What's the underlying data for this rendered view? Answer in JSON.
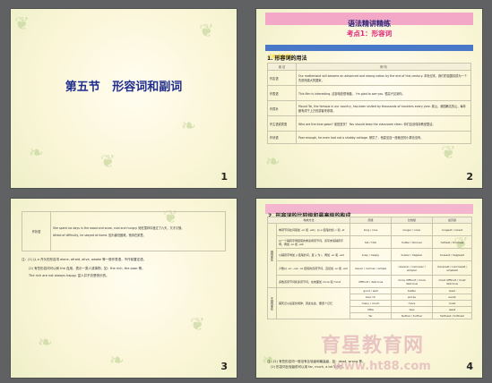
{
  "slides": [
    {
      "number": "1",
      "title_section": "第五节",
      "title_main": "形容词和副词"
    },
    {
      "number": "2",
      "banner": "语法精讲精练",
      "subtitle": "考点1：形容词",
      "tag": "【考点精讲】",
      "heading": "1. 形容词的用法",
      "table_header": [
        "用 法",
        "例 句"
      ],
      "rows": [
        {
          "use": "作定语",
          "example": "Our motherland will become an advanced and strong nation by the end of this century. 本世纪末，我们的祖国将成为一个先进而强大的国家。"
        },
        {
          "use": "作表语",
          "example": "This film is interesting. 这部电影很有趣。 I'm glad to see you. 很高兴见到你。"
        },
        {
          "use": "作宾补",
          "example": "Mount Tai, the famous in our country, has been visited by thousands of travelers every year. 泰山，我国著名的山，每年都有成千上万的游客来参观。"
        },
        {
          "use": "作主语或宾语",
          "example": "Who are the blue gown? 谁是蓝衣？ You should keep the classroom clean. 你们应该保持教室整洁。"
        },
        {
          "use": "作状语",
          "example": "Poor enough, he even had not a shabby cottage. 够穷了，他甚至连一座破旧的小屋也没有。"
        }
      ]
    },
    {
      "number": "3",
      "cell_label": "作状语",
      "cell_text_1": "She spent six days in the wood and snow, cold and hungry. 她在雪林中度过了六天，又冷又饿。",
      "cell_text_2": "Afraid of difficulty, he stayed at home. 因为害怕困难，他待在家里。",
      "note_1": "注：(1) 以 a 开头的形容词 alone, afraid, alive, awake 等一般作表语，不作前置定语。",
      "note_2": "(2) 有些形容词可以和 the 连用，表示一类人或事物，如：the rich, the poor 等。",
      "note_3": "The rich are not always happy. 富人并不总是快乐的。"
    },
    {
      "number": "4",
      "heading": "2. 形容词的比较级和最高级的构成",
      "table_header": [
        "构成方法",
        "原级",
        "比较级",
        "最高级"
      ],
      "group_regular": "规则变化",
      "group_irregular": "不规则变化",
      "rows": [
        {
          "rule": "单音节词在词尾加 -er 和 -est；以 e 结尾的加 -r 和 -st",
          "pos": "long / nice",
          "comp": "longer / nicer",
          "sup": "longest / nicest"
        },
        {
          "rule": "以一个辅音字母结尾的重读闭音节词，双写末尾辅音字母，再加 -er 和 -est",
          "pos": "hot / thin",
          "comp": "hotter / thinner",
          "sup": "hottest / thinnest"
        },
        {
          "rule": "以辅音字母加 y 结尾的词，变 y 为 i，再加 -er 和 -est",
          "pos": "busy / happy",
          "comp": "busier / happier",
          "sup": "busiest / happiest"
        },
        {
          "rule": "少数以 -er, -ow, -le 结尾的双音节词，直接加 -er 和 -est",
          "pos": "clever / narrow / simple",
          "comp": "cleverer / narrower / simpler",
          "sup": "cleverest / narrowest / simplest"
        },
        {
          "rule": "多数双音节词和多音节词，在前面加 more 和 most",
          "pos": "difficult / delicious",
          "comp": "more difficult / more delicious",
          "sup": "most difficult / most delicious"
        },
        {
          "rule": "",
          "pos": "good / well",
          "comp": "better",
          "sup": "best"
        },
        {
          "rule": "",
          "pos": "bad / ill",
          "comp": "worse",
          "sup": "worst"
        },
        {
          "rule": "需死记以后变化规律，因此在此，要逐个记忆",
          "pos": "many / much",
          "comp": "more",
          "sup": "most"
        },
        {
          "rule": "",
          "pos": "little",
          "comp": "less",
          "sup": "least"
        },
        {
          "rule": "",
          "pos": "far",
          "comp": "farther / further",
          "sup": "farthest / furthest"
        }
      ],
      "note_1": "注：(1) 有些形容词一般没有比较级和最高级，如：dead, wrong 等。",
      "note_2": "(2) 形容词比较级前可以用 far, much, a lot 等修饰。"
    }
  ],
  "watermark_cn": "育星教育网",
  "watermark_url": "www.ht88.com"
}
